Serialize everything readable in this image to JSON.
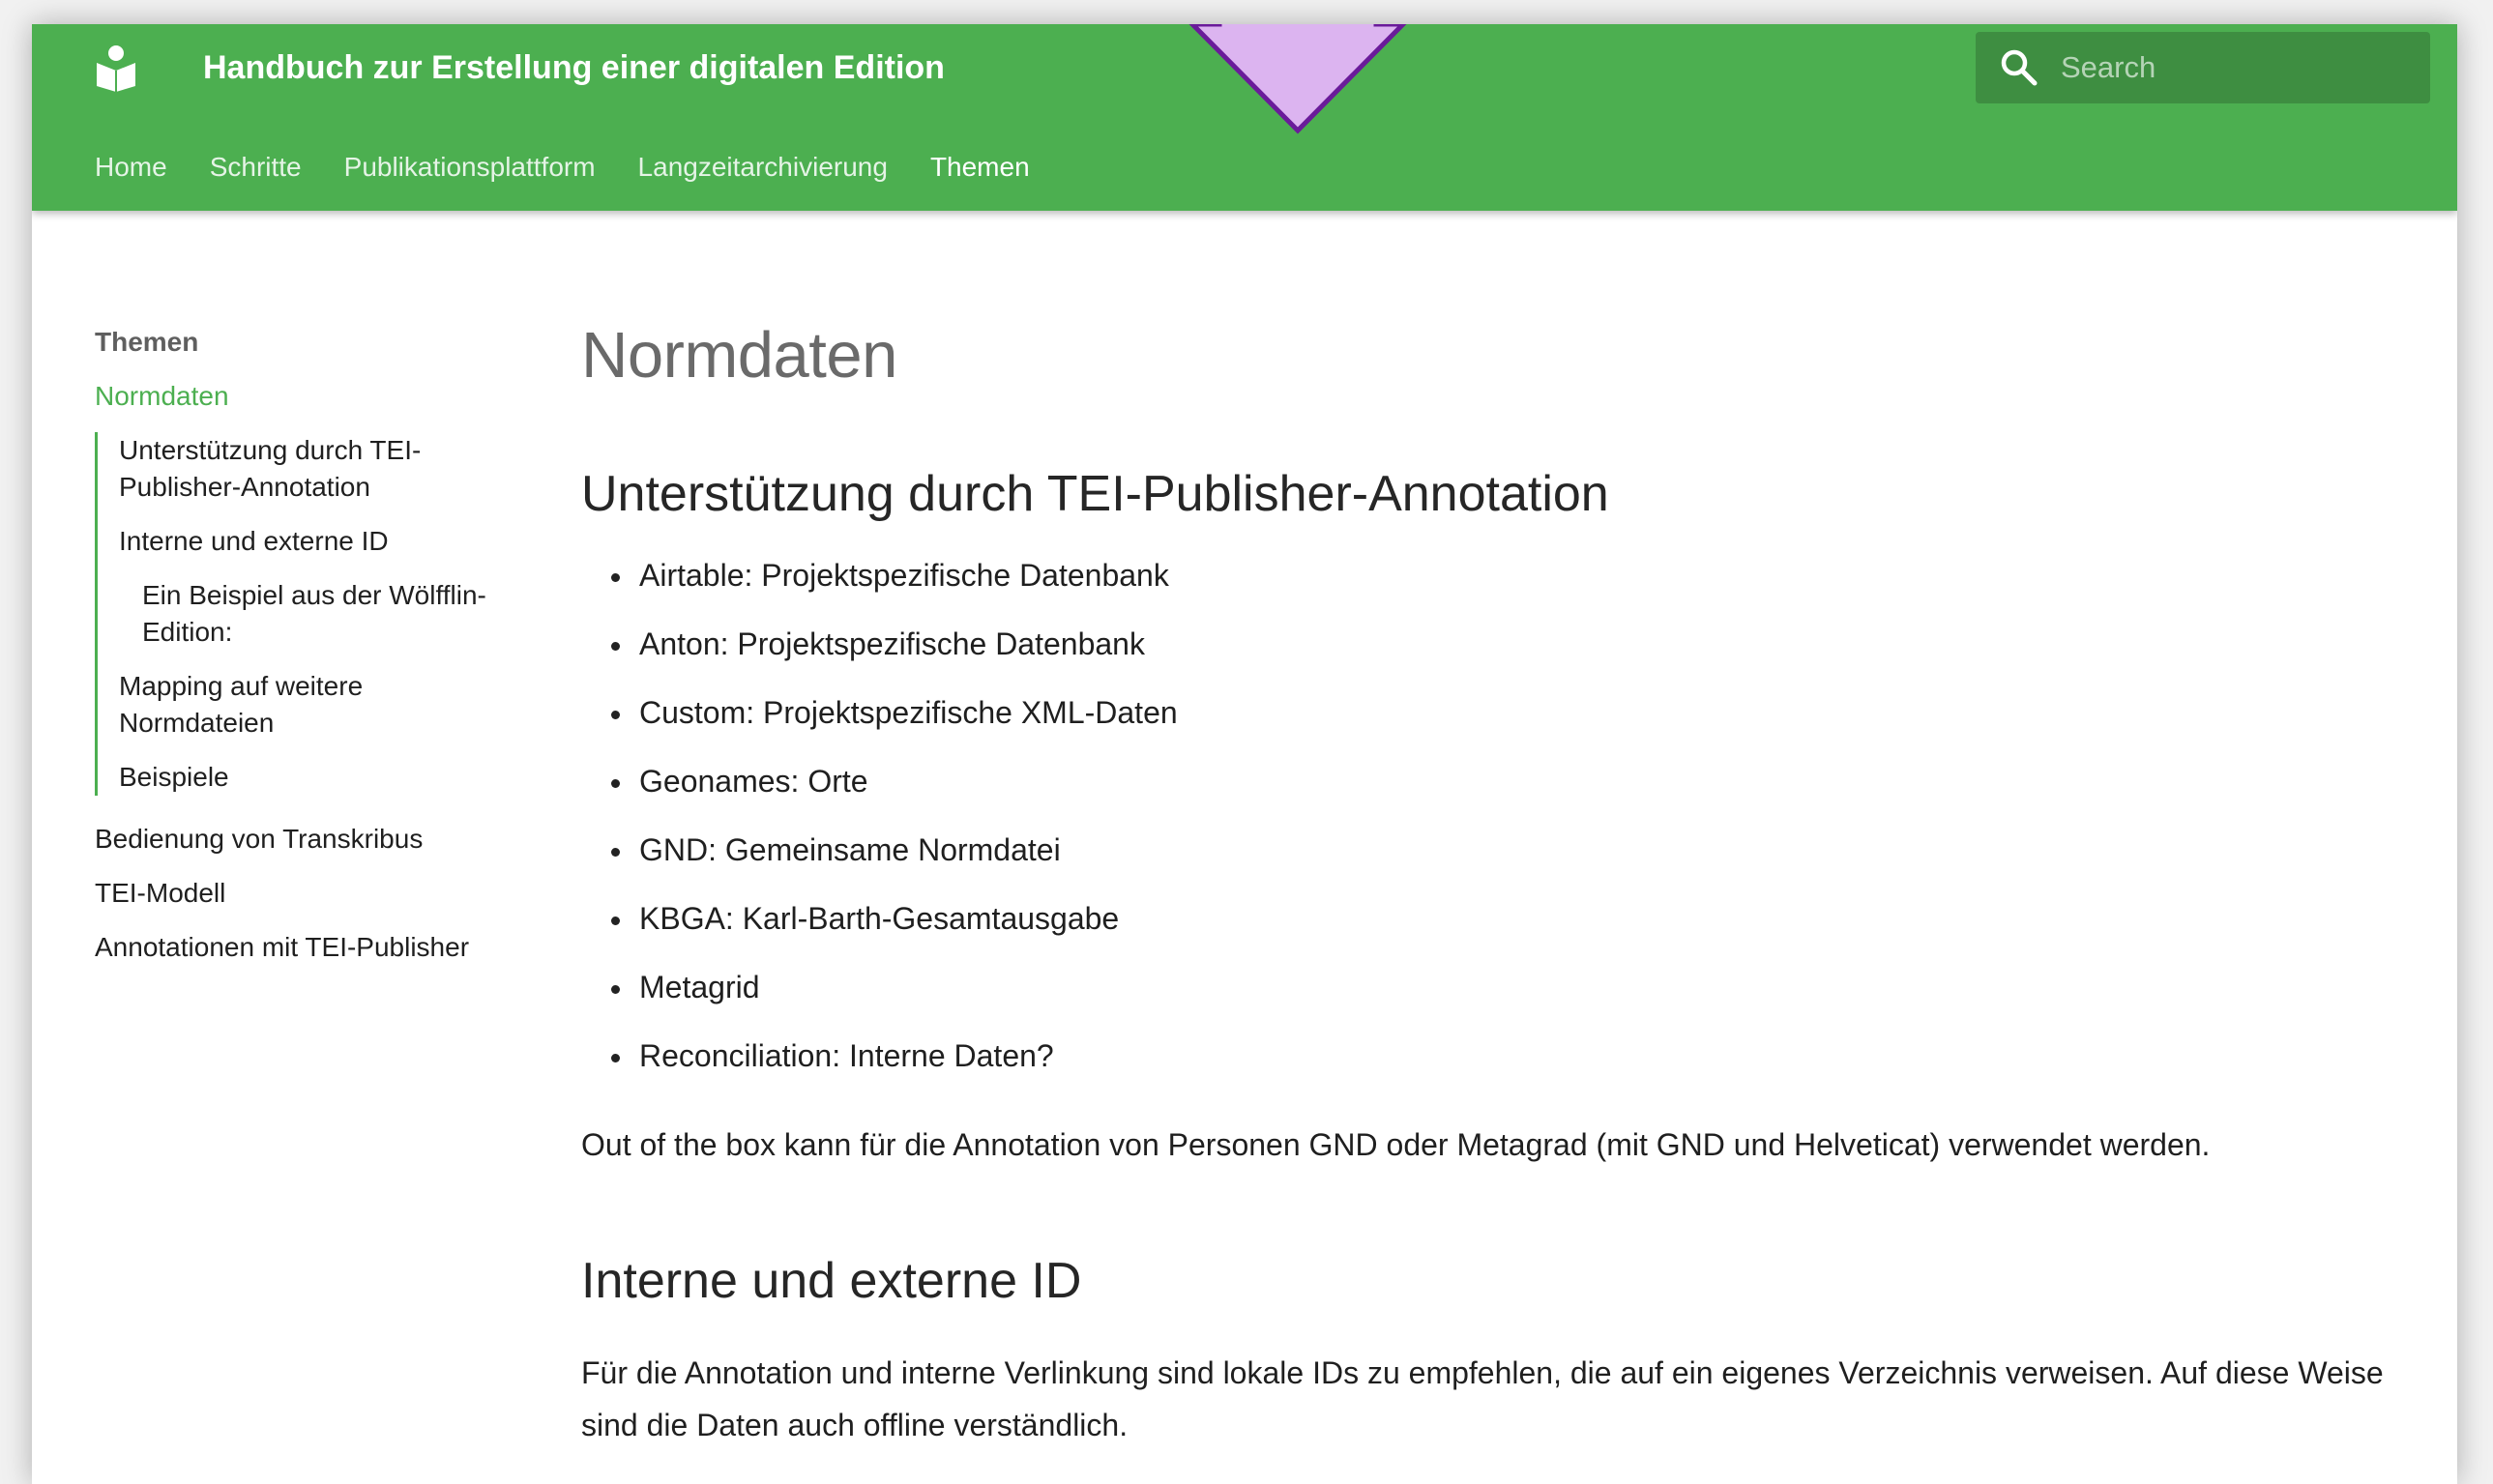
{
  "header": {
    "site_title": "Handbuch zur Erstellung einer digitalen Edition",
    "search_placeholder": "Search",
    "tabs": [
      "Home",
      "Schritte",
      "Publikationsplattform",
      "Langzeitarchivierung",
      "Themen"
    ],
    "active_tab": "Themen",
    "logo_icon": "book-reader-icon",
    "search_icon": "magnifier-icon"
  },
  "sidebar": {
    "heading": "Themen",
    "current": "Normdaten",
    "toc": [
      "Unterstützung durch TEI-Publisher-Annotation",
      "Interne und externe ID",
      "Ein Beispiel aus der Wölfflin-Edition:",
      "Mapping auf weitere Normdateien",
      "Beispiele"
    ],
    "items": [
      "Bedienung von Transkribus",
      "TEI-Modell",
      "Annotationen mit TEI-Publisher"
    ]
  },
  "content": {
    "title": "Normdaten",
    "section1_heading": "Unterstützung durch TEI-Publisher-Annotation",
    "bullets": [
      "Airtable: Projektspezifische Datenbank",
      "Anton: Projektspezifische Datenbank",
      "Custom: Projektspezifische XML-Daten",
      "Geonames: Orte",
      "GND: Gemeinsame Normdatei",
      "KBGA: Karl-Barth-Gesamtausgabe",
      "Metagrid",
      "Reconciliation: Interne Daten?"
    ],
    "paragraph1": "Out of the box kann für die Annotation von Personen GND oder Metagrad (mit GND und Helveticat) verwendet werden.",
    "section2_heading": "Interne und externe ID",
    "paragraph2": "Für die Annotation und interne Verlinkung sind lokale IDs zu empfehlen, die auf ein eigenes Verzeichnis verweisen. Auf diese Weise sind die Daten auch offline verständlich."
  },
  "colors": {
    "primary": "#4caf50",
    "search_bg": "#3e8e41",
    "arrow_fill": "#dcb4f0",
    "arrow_stroke": "#6a1b9a"
  }
}
